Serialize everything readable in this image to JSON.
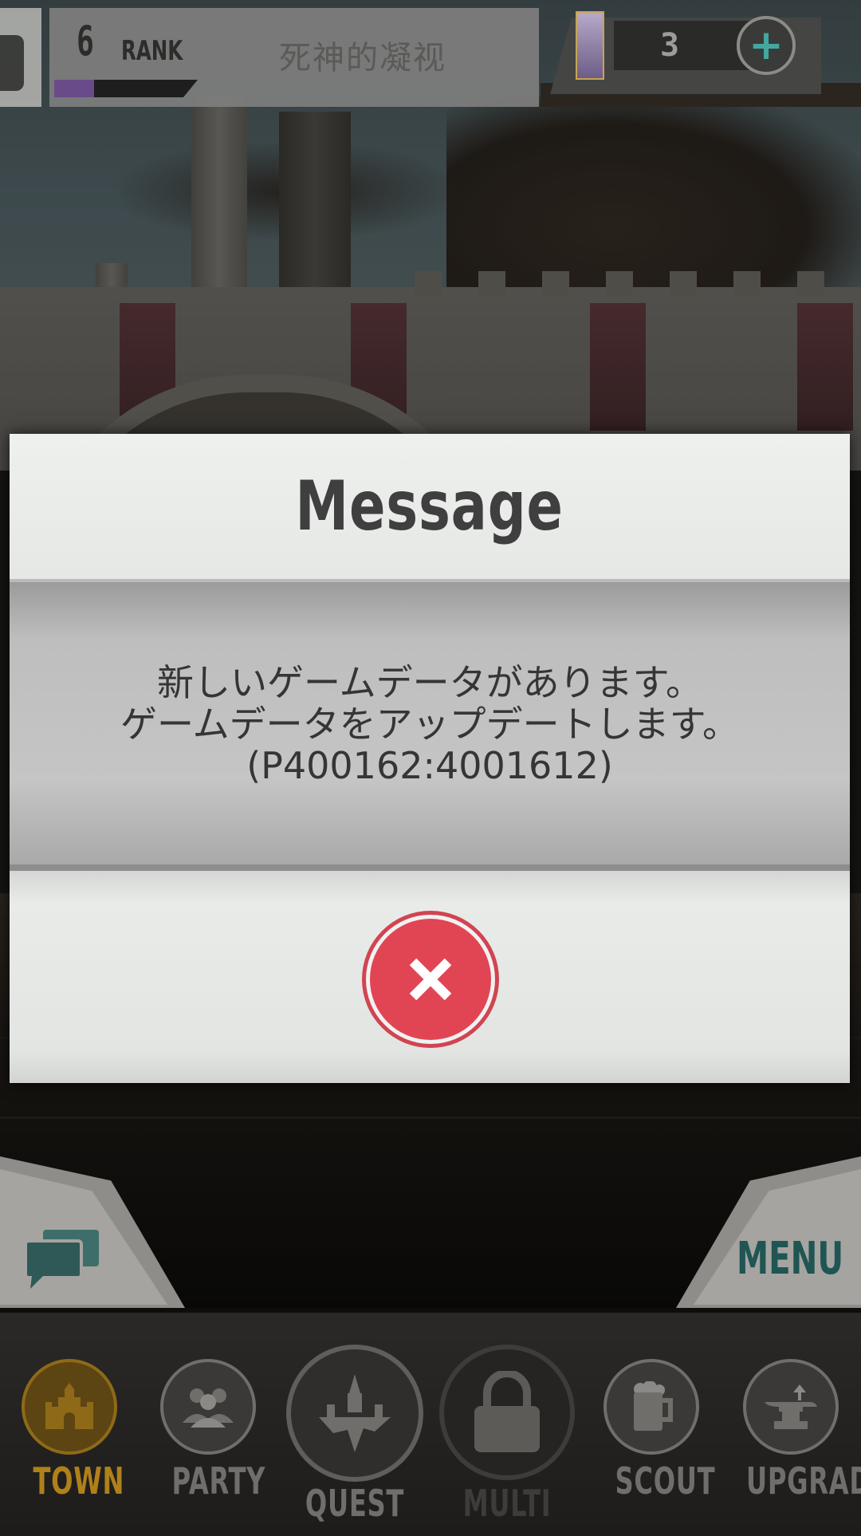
{
  "hud": {
    "level": "6",
    "rank_label": "RANK",
    "player_name": "死神的凝视",
    "item_count": "3",
    "exp_progress": 0.28
  },
  "side_controls": {
    "chat_icon": "chat-bubbles-icon",
    "menu_label": "MENU"
  },
  "dialog": {
    "title": "Message",
    "lines": [
      "新しいゲームデータがあります。",
      "ゲームデータをアップデートします。",
      "(P400162:4001612)"
    ],
    "close_icon": "close-icon"
  },
  "nav": {
    "items": [
      {
        "label": "TOWN",
        "icon": "castle-icon",
        "active": true
      },
      {
        "label": "PARTY",
        "icon": "people-icon",
        "active": false
      },
      {
        "label": "QUEST",
        "icon": "floating-island-icon",
        "active": false
      },
      {
        "label": "MULTI",
        "icon": "lock-icon",
        "active": false,
        "locked": true
      },
      {
        "label": "SCOUT",
        "icon": "beer-mug-icon",
        "active": false
      },
      {
        "label": "UPGRADE",
        "icon": "anvil-icon",
        "active": false
      }
    ]
  },
  "colors": {
    "accent_active": "#d39a1b",
    "close_red": "#e14553",
    "menu_teal": "#1f5552",
    "plus_teal": "#42a7a1"
  }
}
